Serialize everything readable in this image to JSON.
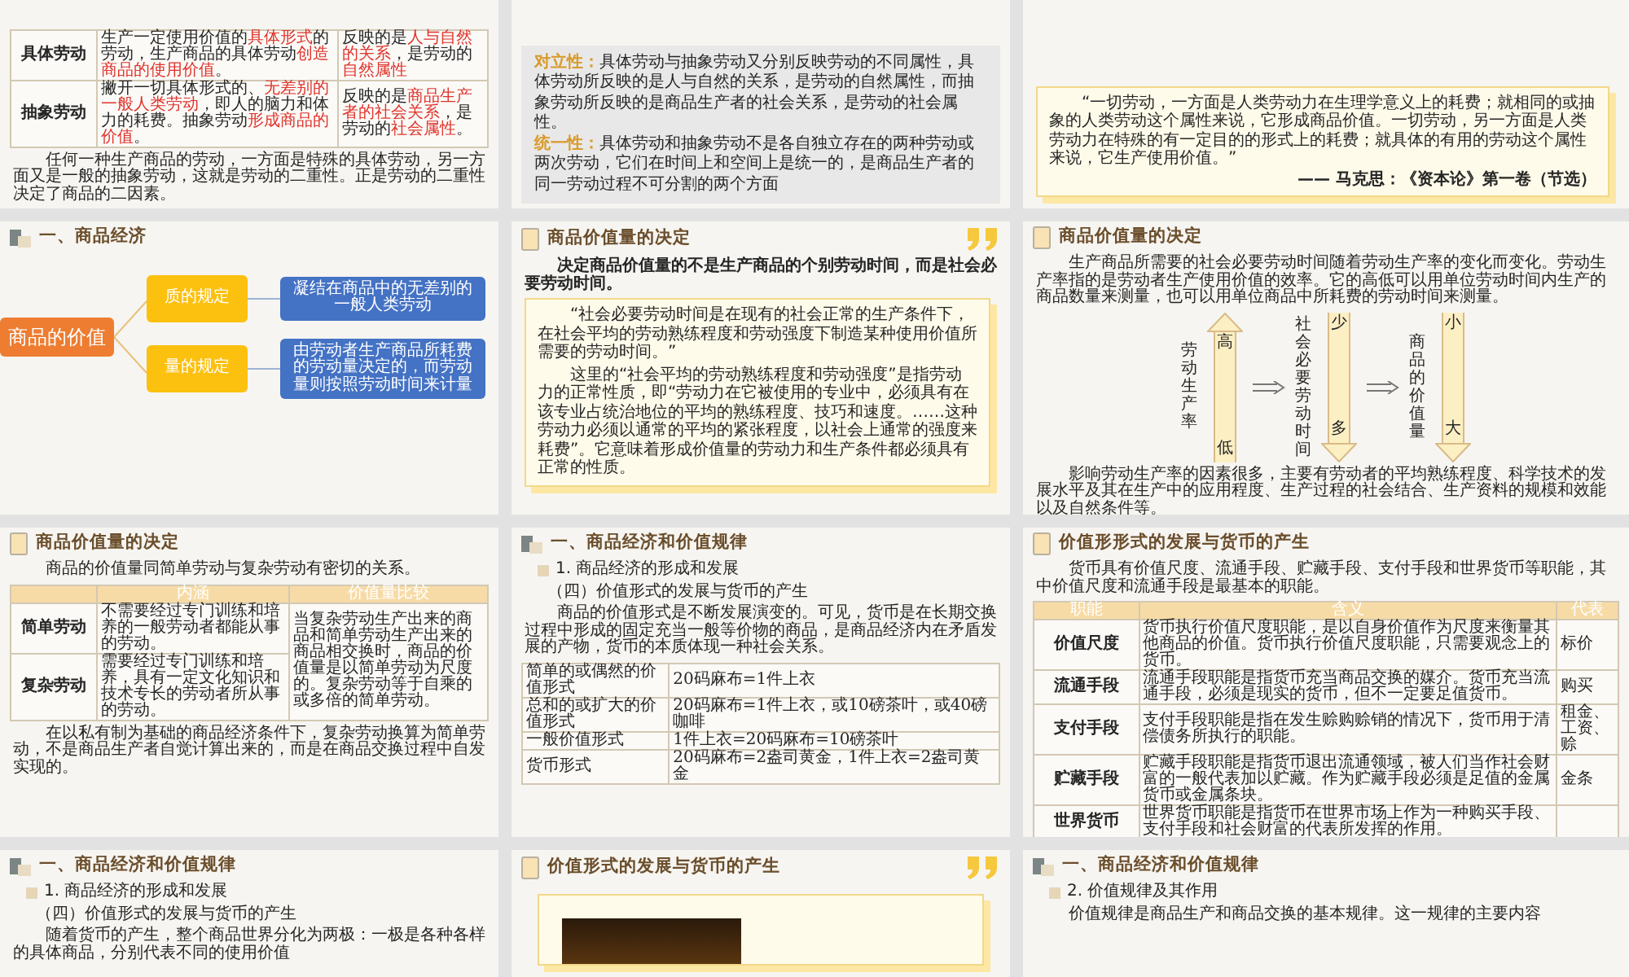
{
  "slides": [
    {
      "blocks": [
        {
          "kind": "table",
          "label_column": true,
          "rows": [
            [
              "具体劳动",
              "生产一定使用价值的**具体形式**的劳动，生产商品的具体劳动**创造商品的使用价值**。",
              "反映的是**人与自然的关系**，是劳动的**自然属性**"
            ],
            [
              "抽象劳动",
              "撇开一切具体形式的、**无差别的一般人类劳动**，即人的脑力和体力的耗费。抽象劳动**形成商品的价值**。",
              "反映的是**商品生产者的社会关系**，是劳动的**社会属性**。"
            ]
          ]
        },
        {
          "kind": "para",
          "text": "任何一种生产商品的劳动，一方面是特殊的具体劳动，另一方面又是一般的抽象劳动，这就是劳动的二重性。正是劳动的二重性决定了商品的二因素。"
        }
      ]
    },
    {
      "blocks": [
        {
          "kind": "note",
          "items": [
            "**对立性：**具体劳动与抽象劳动又分别反映劳动的不同属性，具体劳动所反映的是人与自然的关系，是劳动的自然属性，而抽象劳动所反映的是商品生产者的社会关系，是劳动的社会属性。",
            "**统一性：**具体劳动和抽象劳动不是各自独立存在的两种劳动或两次劳动，它们在时间上和空间上是统一的，是商品生产者的同一劳动过程不可分割的两个方面"
          ]
        }
      ]
    },
    {
      "blocks": [
        {
          "kind": "quote",
          "paragraphs": [
            "“一切劳动，一方面是人类劳动力在生理学意义上的耗费；就相同的或抽象的人类劳动这个属性来说，它形成商品价值。一切劳动，另一方面是人类劳动力在特殊的有一定目的的形式上的耗费；就具体的有用的劳动这个属性来说，它生产使用价值。”"
          ],
          "source": "—— 马克思：《资本论》第一卷（节选）"
        }
      ]
    },
    {
      "heading": {
        "kind": "section",
        "text": "一、商品经济"
      },
      "blocks": [
        {
          "kind": "mindmap",
          "root": "商品的价值",
          "branches": [
            {
              "label": "质的规定",
              "detail": "凝结在商品中的无差别的一般人类劳动"
            },
            {
              "label": "量的规定",
              "detail": "由劳动者生产商品所耗费的劳动量决定的，而劳动量则按照劳动时间来计量"
            }
          ]
        }
      ]
    },
    {
      "heading": {
        "kind": "topic",
        "text": "商品价值量的决定"
      },
      "quote_mark": true,
      "blocks": [
        {
          "kind": "lead",
          "text": "决定商品价值量的不是生产商品的个别劳动时间，而是社会必要劳动时间。"
        },
        {
          "kind": "quote",
          "paragraphs": [
            "“社会必要劳动时间是在现有的社会正常的生产条件下，在社会平均的劳动熟练程度和劳动强度下制造某种使用价值所需要的劳动时间。”",
            "这里的“社会平均的劳动熟练程度和劳动强度”是指劳动力的正常性质，即“劳动力在它被使用的专业中，必须具有在该专业占统治地位的平均的熟练程度、技巧和速度。……这种劳动力必须以通常的平均的紧张程度，以社会上通常的强度来耗费”。它意味着形成价值量的劳动力和生产条件都必须具有正常的性质。"
          ]
        }
      ]
    },
    {
      "heading": {
        "kind": "topic",
        "text": "商品价值量的决定"
      },
      "blocks": [
        {
          "kind": "para",
          "text": "生产商品所需要的社会必要劳动时间随着劳动生产率的变化而变化。劳动生产率指的是劳动者生产使用价值的效率。它的高低可以用单位劳动时间内生产的商品数量来测量，也可以用单位商品中所耗费的劳动时间来测量。"
        },
        {
          "kind": "diagram",
          "columns": [
            {
              "label": "劳动生产率",
              "kind": "up",
              "top": "高",
              "bottom": "低"
            },
            {
              "label": "社会必要劳动时间",
              "kind": "down",
              "top": "少",
              "bottom": "多"
            },
            {
              "label": "商品的价值量",
              "kind": "down",
              "top": "小",
              "bottom": "大"
            }
          ]
        },
        {
          "kind": "para",
          "text": "影响劳动生产率的因素很多，主要有劳动者的平均熟练程度、科学技术的发展水平及其在生产中的应用程度、生产过程的社会结合、生产资料的规模和效能以及自然条件等。"
        }
      ]
    },
    {
      "heading": {
        "kind": "topic",
        "text": "商品价值量的决定"
      },
      "blocks": [
        {
          "kind": "para",
          "text": "商品的价值量同简单劳动与复杂劳动有密切的关系。"
        },
        {
          "kind": "table",
          "label_column": true,
          "columns": [
            "",
            "内涵",
            "价值量比较"
          ],
          "rows": [
            [
              "简单劳动",
              "不需要经过专门训练和培养的一般劳动者都能从事的劳动。"
            ],
            [
              "复杂劳动",
              "需要经过专门训练和培养，具有一定文化知识和技术专长的劳动者所从事的劳动。"
            ]
          ],
          "shared_cell": "当复杂劳动生产出来的商品和简单劳动生产出来的商品相交换时，商品的价值量是以简单劳动为尺度的。复杂劳动等于自乘的或多倍的简单劳动。"
        },
        {
          "kind": "para",
          "text": "在以私有制为基础的商品经济条件下，复杂劳动换算为简单劳动，不是商品生产者自觉计算出来的，而是在商品交换过程中自发实现的。"
        }
      ]
    },
    {
      "heading": {
        "kind": "section",
        "text": "一、商品经济和价值规律"
      },
      "blocks": [
        {
          "kind": "sub",
          "text": "1. 商品经济的形成和发展"
        },
        {
          "kind": "subsub",
          "text": "（四）价值形式的发展与货币的产生"
        },
        {
          "kind": "para",
          "text": "商品的价值形式是不断发展演变的。可见，货币是在长期交换过程中形成的固定充当一般等价物的商品，是商品经济内在矛盾发展的产物，货币的本质体现一种社会关系。"
        },
        {
          "kind": "table",
          "label_column": false,
          "rows": [
            [
              "简单的或偶然的价值形式",
              "20码麻布=1件上衣"
            ],
            [
              "总和的或扩大的价值形式",
              "20码麻布=1件上衣，或10磅茶叶，或40磅咖啡"
            ],
            [
              "一般价值形式",
              "1件上衣=20码麻布=10磅茶叶"
            ],
            [
              "货币形式",
              "20码麻布=2盎司黄金，1件上衣=2盎司黄金"
            ]
          ]
        }
      ]
    },
    {
      "heading": {
        "kind": "topic",
        "text": "价值形形式的发展与货币的产生"
      },
      "blocks": [
        {
          "kind": "para",
          "text": "货币具有价值尺度、流通手段、贮藏手段、支付手段和世界货币等职能，其中价值尺度和流通手段是最基本的职能。"
        },
        {
          "kind": "table",
          "label_column": true,
          "columns": [
            "职能",
            "含义",
            "代表"
          ],
          "rows": [
            [
              "价值尺度",
              "货币执行价值尺度职能，是以自身价值作为尺度来衡量其他商品的价值。货币执行价值尺度职能，只需要观念上的货币。",
              "标价"
            ],
            [
              "流通手段",
              "流通手段职能是指货币充当商品交换的媒介。货币充当流通手段，必须是现实的货币，但不一定要足值货币。",
              "购买"
            ],
            [
              "支付手段",
              "支付手段职能是指在发生赊购赊销的情况下，货币用于清偿债务所执行的职能。",
              "租金、工资、赊"
            ],
            [
              "贮藏手段",
              "贮藏手段职能是指货币退出流通领域，被人们当作社会财富的一般代表加以贮藏。作为贮藏手段必须是足值的金属货币或金属条块。",
              "金条"
            ],
            [
              "世界货币",
              "世界货币职能是指货币在世界市场上作为一种购买手段、支付手段和社会财富的代表所发挥的作用。"
            ]
          ]
        }
      ]
    },
    {
      "heading": {
        "kind": "section",
        "text": "一、商品经济和价值规律"
      },
      "blocks": [
        {
          "kind": "sub",
          "text": "1. 商品经济的形成和发展"
        },
        {
          "kind": "subsub",
          "text": "（四）价值形式的发展与货币的产生"
        },
        {
          "kind": "para",
          "text": "随着货币的产生，整个商品世界分化为两极：一极是各种各样的具体商品，分别代表不同的使用价值"
        }
      ]
    },
    {
      "heading": {
        "kind": "topic",
        "text": "价值形式的发展与货币的产生"
      },
      "quote_mark": true,
      "blocks": [
        {
          "kind": "photo"
        }
      ]
    },
    {
      "heading": {
        "kind": "section",
        "text": "一、商品经济和价值规律"
      },
      "blocks": [
        {
          "kind": "sub",
          "text": "2. 价值规律及其作用"
        },
        {
          "kind": "para",
          "text": "价值规律是商品生产和商品交换的基本规律。这一规律的主要内容"
        }
      ]
    }
  ]
}
